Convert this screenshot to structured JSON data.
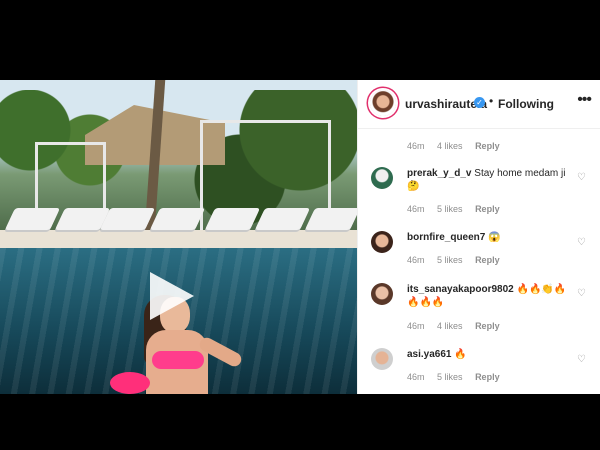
{
  "header": {
    "username": "urvashirautela",
    "verified_icon": "✓",
    "separator": "•",
    "follow_label": "Following",
    "more_icon": "•••"
  },
  "media": {
    "play_icon": "play-icon"
  },
  "comments": [
    {
      "username": "",
      "text": "",
      "time": "46m",
      "likes": "4 likes",
      "reply": "Reply"
    },
    {
      "username": "prerak_y_d_v",
      "text": "Stay home medam ji🤔",
      "time": "46m",
      "likes": "5 likes",
      "reply": "Reply"
    },
    {
      "username": "bornfire_queen7",
      "text": "😱",
      "time": "46m",
      "likes": "5 likes",
      "reply": "Reply"
    },
    {
      "username": "its_sanayakapoor9802",
      "text": "🔥🔥👏🔥🔥🔥🔥",
      "time": "46m",
      "likes": "4 likes",
      "reply": "Reply"
    },
    {
      "username": "asi.ya661",
      "text": "🔥",
      "time": "46m",
      "likes": "5 likes",
      "reply": "Reply"
    }
  ],
  "colors": {
    "accent": "#3897f0",
    "meta": "#8e8e8e",
    "text": "#262626"
  }
}
